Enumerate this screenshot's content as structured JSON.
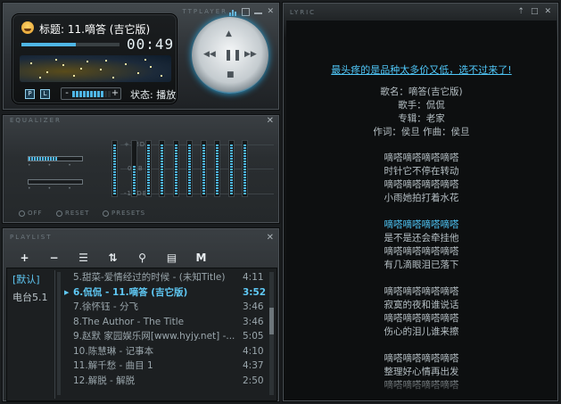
{
  "player": {
    "brand": "TTPLAYER",
    "title": "标题: 11.嘀答 (吉它版)",
    "time": "00:49",
    "progress": 0.55,
    "volume": 0.85,
    "status": "状态: 播放",
    "p_label": "P",
    "l_label": "L",
    "vol_minus": "-",
    "vol_plus": "+"
  },
  "equalizer": {
    "title": "EQUALIZER",
    "db_top": "+12DB",
    "db_mid": "0DB",
    "db_bot": "-12DB",
    "options": [
      "OFF",
      "RESET",
      "PRESETS"
    ],
    "bands": [
      0.95,
      0.55,
      0.95,
      0.95,
      0.95,
      0.95,
      0.95,
      0.95,
      0.95,
      0.95
    ]
  },
  "playlist": {
    "title": "PLAYLIST",
    "tools": [
      "+",
      "−",
      "☰",
      "⇅",
      "⚲",
      "▤",
      "M"
    ],
    "groups": [
      "[默认]",
      "电台5.1"
    ],
    "tracks": [
      {
        "title": "5.甜菜-爱情经过的时候 - (未知Title)",
        "dur": "4:11"
      },
      {
        "title": "6.侃侃 - 11.嘀答 (吉它版)",
        "dur": "3:52"
      },
      {
        "title": "7.徐怀钰 - 分飞",
        "dur": "3:46"
      },
      {
        "title": "8.The Author - The Title",
        "dur": "3:46"
      },
      {
        "title": "9.赵默 家园娱乐网[www.hyjy.net] -...",
        "dur": "5:05"
      },
      {
        "title": "10.陈慧琳 - 记事本",
        "dur": "4:10"
      },
      {
        "title": "11.解千愁 - 曲目 1",
        "dur": "4:37"
      },
      {
        "title": "12.解脱 - 解脱",
        "dur": "2:50"
      }
    ]
  },
  "lyric": {
    "title": "LYRIC",
    "ad": "最头疼的是品种太多价又低，选不过来了!",
    "meta": [
      "歌名：嘀答(吉它版)",
      "歌手：侃侃",
      "专辑：老家",
      "作词：侯旦 作曲：侯旦"
    ],
    "lines": [
      "嘀嗒嘀嗒嘀嗒嘀嗒",
      "时针它不停在转动",
      "嘀嗒嘀嗒嘀嗒嘀嗒",
      "小雨她拍打着水花",
      "嘀嗒嘀嗒嘀嗒嘀嗒",
      "是不是还会牵挂他",
      "嘀嗒嘀嗒嘀嗒嘀嗒",
      "有几滴眼泪已落下",
      "嘀嗒嘀嗒嘀嗒嘀嗒",
      "寂寞的夜和谁说话",
      "嘀嗒嘀嗒嘀嗒嘀嗒",
      "伤心的泪儿谁来擦",
      "嘀嗒嘀嗒嘀嗒嘀嗒",
      "整理好心情再出发",
      "嘀嗒嘀嗒嘀嗒嘀嗒"
    ]
  },
  "colors": {
    "accent": "#4fb6e6",
    "lyric_highlight": "#4fc6f7"
  }
}
